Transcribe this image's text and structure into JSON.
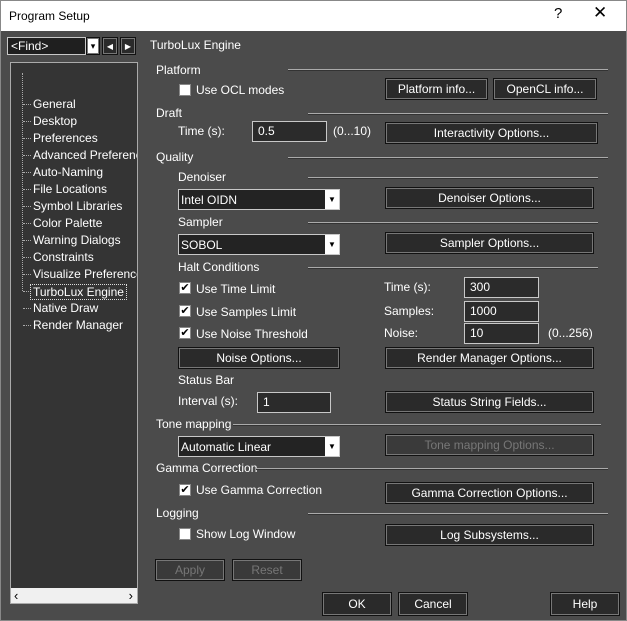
{
  "window": {
    "title": "Program Setup",
    "help_glyph": "?",
    "close_glyph": "✕"
  },
  "find": {
    "value": "<Find>",
    "arrow": "▾",
    "prev": "◀",
    "next": "▶"
  },
  "tree": {
    "items": [
      "General",
      "Desktop",
      "Preferences",
      "Advanced Preferences",
      "Auto-Naming",
      "File Locations",
      "Symbol Libraries",
      "Color Palette",
      "Warning Dialogs",
      "Constraints",
      "Visualize Preferences",
      "TurboLux Engine",
      "Native Draw",
      "Render Manager"
    ],
    "selected": "TurboLux Engine",
    "scroll_left": "‹",
    "scroll_right": "›"
  },
  "panel_title": "TurboLux Engine",
  "platform": {
    "header": "Platform",
    "use_ocl": "Use OCL modes",
    "use_ocl_checked": false,
    "info_btn": "Platform info...",
    "opencl_btn": "OpenCL info..."
  },
  "draft": {
    "header": "Draft",
    "time_label": "Time (s):",
    "time_value": "0.5",
    "range": "(0...10)",
    "options_btn": "Interactivity Options..."
  },
  "quality": {
    "header": "Quality",
    "denoiser": {
      "header": "Denoiser",
      "value": "Intel OIDN",
      "options_btn": "Denoiser Options..."
    },
    "sampler": {
      "header": "Sampler",
      "value": "SOBOL",
      "options_btn": "Sampler Options..."
    },
    "halt": {
      "header": "Halt Conditions",
      "use_time": "Use Time Limit",
      "use_samples": "Use Samples Limit",
      "use_noise": "Use Noise Threshold",
      "time_label": "Time (s):",
      "time_value": "300",
      "samples_label": "Samples:",
      "samples_value": "1000",
      "noise_label": "Noise:",
      "noise_value": "10",
      "noise_range": "(0...256)",
      "noise_btn": "Noise Options...",
      "render_mgr_btn": "Render Manager Options..."
    },
    "status": {
      "header": "Status Bar",
      "interval_label": "Interval (s):",
      "interval_value": "1",
      "fields_btn": "Status String Fields..."
    }
  },
  "tone": {
    "header": "Tone mapping",
    "value": "Automatic Linear",
    "options_btn": "Tone mapping Options..."
  },
  "gamma": {
    "header": "Gamma Correction",
    "use": "Use Gamma Correction",
    "options_btn": "Gamma Correction Options..."
  },
  "logging": {
    "header": "Logging",
    "show": "Show Log Window",
    "subsystems_btn": "Log Subsystems..."
  },
  "footer": {
    "apply": "Apply",
    "reset": "Reset",
    "ok": "OK",
    "cancel": "Cancel",
    "help": "Help"
  },
  "check": "✔"
}
